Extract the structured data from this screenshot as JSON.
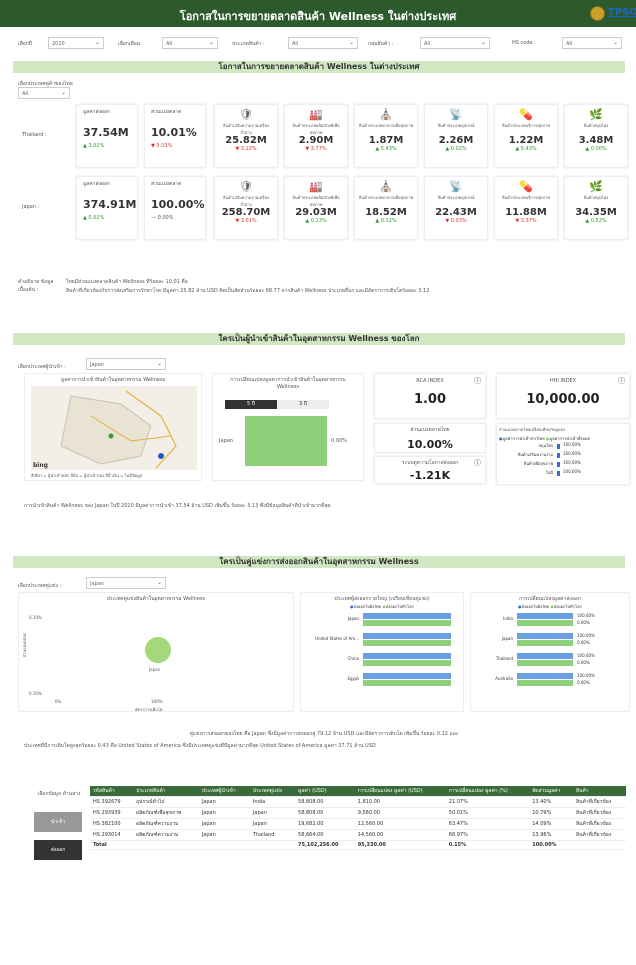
{
  "header": {
    "title": "โอกาสในการขยายตลาดสินค้า Wellness ในต่างประเทศ",
    "logo_text": "TPSO"
  },
  "filters": [
    {
      "label": "เลือกปี",
      "value": "2020"
    },
    {
      "label": "เลือกเดือน",
      "value": "All"
    },
    {
      "label": "ประเภทสินค้า :",
      "value": "All"
    },
    {
      "label": "กลุ่มสินค้า :",
      "value": "All"
    },
    {
      "label": "HS code :",
      "value": "All"
    }
  ],
  "section1": {
    "band": "โอกาสในการขยายตลาดสินค้า Wellness ในต่างประเทศ",
    "partner_label": "เลือกประเทศคู่ค้าของไทย",
    "partner_value": "All",
    "col_export": "มูลค่าส่งออก",
    "col_share": "ส่วนแบ่งตลาด",
    "categories": [
      "สินค้าเสริมความงามเครื่องสำอาง",
      "สินค้าประเภทผลิตภัณฑ์เพื่อสุขภาพ",
      "สินค้าประเภทอาหารเพื่อสุขภาพ",
      "สินค้าประเภทอุปกรณ์",
      "สินค้าประเภทบริการสุขภาพ",
      "สินค้าสมุนไพร"
    ],
    "rows": [
      {
        "country": "Thailand :",
        "export": "37.54M",
        "export_chg": "▲ 3.02%",
        "share": "10.01%",
        "share_chg": "▼ 3.03%",
        "cats": [
          {
            "v": "25.82M",
            "c": "▼ 3.12%",
            "d": "dn"
          },
          {
            "v": "2.90M",
            "c": "▼ 3.77%",
            "d": "dn"
          },
          {
            "v": "1.87M",
            "c": "▲ 5.43%",
            "d": "up"
          },
          {
            "v": "2.26M",
            "c": "▲ 0.02%",
            "d": "up"
          },
          {
            "v": "1.22M",
            "c": "▲ 5.43%",
            "d": "up"
          },
          {
            "v": "3.48M",
            "c": "▲ 0.00%",
            "d": "up"
          }
        ]
      },
      {
        "country": "Japan :",
        "export": "374.91M",
        "export_chg": "▲ 0.02%",
        "share": "100.00%",
        "share_chg": "— 0.00%",
        "cats": [
          {
            "v": "258.70M",
            "c": "▼ 3.01%",
            "d": "dn"
          },
          {
            "v": "29.03M",
            "c": "▲ 0.13%",
            "d": "up"
          },
          {
            "v": "18.52M",
            "c": "▲ 0.12%",
            "d": "up"
          },
          {
            "v": "22.43M",
            "c": "▼ 0.03%",
            "d": "dn"
          },
          {
            "v": "11.88M",
            "c": "▼ 3.37%",
            "d": "dn"
          },
          {
            "v": "34.35M",
            "c": "▲ 0.52%",
            "d": "up"
          }
        ]
      }
    ],
    "summary_label": "คำอธิบาย ข้อมูลเบื้องต้น :",
    "summary1": "ไทยมีส่วนแบ่งตลาดสินค้า Wellness ที่ร้อยละ 10.01 คือ",
    "summary2": "สินค้าที่เกี่ยวข้องกับการส่งเสริมการรักษาโรค มีมูลค่า 25.82 ล้าน USD คิดเป็นสัดส่วนร้อยละ 68.77 จากสินค้า Wellness ประเภทอื่นๆ และมีอัตราการเติบโตร้อยละ 3.12"
  },
  "section2": {
    "band": "ใครเป็นผู้นำเข้าสินค้าในอุตสาหกรรม Wellness ของโลก",
    "country_label": "เลือกประเทศผู้นำเข้า :",
    "country_value": "Japan",
    "map_title": "มูลค่าการนำเข้าสินค้าในอุตสาหกรรม Wellness",
    "map_caption": "สีเขียว = ผู้นำเข้าหลัก สีส้ม = ผู้นำเข้ารอง สีน้ำเงิน = ไม่มีข้อมูล",
    "map_brand": "bing",
    "bar_title": "การเปลี่ยนแปลงมูลค่าการนำเข้าสินค้าในอุตสาหกรรม Wellness",
    "bar_tabs": [
      "5 ปี",
      "3 ปี"
    ],
    "bar_label": "Japan",
    "bar_value": "0.00%",
    "rca_title": "RCA INDEX",
    "rca_value": "1.00",
    "hhi_title": "HHI INDEX",
    "hhi_value": "10,000.00",
    "share_title": "ส่วนแบ่งตลาดไทย",
    "share_value": "10.00%",
    "opp_title": "ระบบดูความโอกาสส่งออก",
    "opp_value": "-1.21K",
    "sub_title": "ส่วนแบ่งตลาดไทยเปรียบเทียบกับคู่แข่ง",
    "sub_legend": [
      "มูลค่าการนำเข้าจากไทย",
      "มูลค่าการนำเข้าทั้งหมด"
    ],
    "sub_rows": [
      {
        "label": "สมุนไพร",
        "value": "100.00%"
      },
      {
        "label": "สินค้าเสริมความงาม",
        "value": "100.00%"
      },
      {
        "label": "สินค้าเพื่อสุขภาพ",
        "value": "100.00%"
      },
      {
        "label": "ในปี",
        "value": "100.00%"
      }
    ],
    "sub_axis": [
      "0%",
      "50%",
      "100%"
    ],
    "desc": "การนำเข้าสินค้า Wellness ของ Japan ในปี 2020 มีมูลค่าการนำเข้า 37.54 ล้าน USD เพิ่มขึ้น ร้อยละ 3.13 ซึ่งมีข้อมูลสินค้าที่นำเข้ามากที่สุด"
  },
  "section3": {
    "band": "ใครเป็นคู่แข่งการส่งออกสินค้าในอุตสาหกรรม Wellness",
    "country_label": "เลือกประเทศคู่แข่ง :",
    "country_value": "Japan",
    "bubble_title": "ประเทศคู่แข่งสินค้าในอุตสาหกรรม Wellness",
    "bubble_label": "Japan",
    "bubble_ylabel": "ส่วนแบ่งตลาด",
    "bubble_xlabel": "อัตราการเติบโต",
    "bubble_yticks": [
      "0.10%",
      "0.10%"
    ],
    "bubble_xticks": [
      "0%",
      "100%"
    ],
    "bar2_title": "ประเทศผู้ส่งออกรายใหญ่ (เปรียบเทียบคู่แข่ง)",
    "bar2_legend": [
      "ส่งออกไปยังไทย",
      "ส่งออกไปทั่วโลก"
    ],
    "bar2_rows": [
      "Japan",
      "United States of Am...",
      "China",
      "Egypt"
    ],
    "bar3_title": "การเปลี่ยนแปลงมูลค่าส่งออก",
    "bar3_legend": [
      "ส่งออกไปยังไทย",
      "ส่งออกไปทั่วโลก"
    ],
    "bar3_rows": [
      {
        "label": "India",
        "v1": "0.00%",
        "v2": "100.00%"
      },
      {
        "label": "Japan",
        "v1": "0.00%",
        "v2": "100.00%"
      },
      {
        "label": "Thailand",
        "v1": "0.00%",
        "v2": "100.00%"
      },
      {
        "label": "Australia",
        "v1": "0.00%",
        "v2": "100.00%"
      }
    ],
    "desc1": "คู่แข่งการส่งออกของไทย คือ Japan ซึ่งมีมูลค่าการส่งออกสู่ 79.12 ล้าน USD และมีอัตราการเติบโต เพิ่มขึ้น ร้อยละ 0.12 และ",
    "desc2": "ประเทศที่มีการเติบโตสูงสุดร้อยละ 0.43 คือ United States of America ซึ่งมีประเทศคู่แข่งที่มีมูลค่ามากที่สุด United States of America มูลค่า 37.71 ล้าน USD"
  },
  "table": {
    "side_label": "เลือกข้อมูล ด้านล่าง",
    "side_buttons": [
      "นำเข้า",
      "ส่งออก"
    ],
    "headers": [
      "รหัสสินค้า",
      "ประเภทสินค้า",
      "ประเทศผู้นำเข้า",
      "ประเทศคู่แข่ง",
      "มูลค่า (USD)",
      "การเปลี่ยนแปลง มูลค่า (USD)",
      "การเปลี่ยนแปลง มูลค่า (%)",
      "สัดส่วนมูลค่า",
      "สินค้า"
    ],
    "rows": [
      [
        "HS 392679",
        "อุปกรณ์ทั่วไป",
        "Japan",
        "India",
        "58,808.00",
        "1,810.00",
        "21.07%",
        "13.40%",
        "สินค้าที่เกี่ยวข้อง"
      ],
      [
        "HS 293939",
        "ผลิตภัณฑ์เพื่อสุขภาพ",
        "Japan",
        "Japan",
        "58,808.00",
        "9,560.00",
        "50.01%",
        "10.79%",
        "สินค้าที่เกี่ยวข้อง"
      ],
      [
        "HS 382100",
        "ผลิตภัณฑ์ความงาม",
        "Japan",
        "Japan",
        "19,682.00",
        "12,560.00",
        "63.47%",
        "14.09%",
        "สินค้าที่เกี่ยวข้อง"
      ],
      [
        "HS 293014",
        "ผลิตภัณฑ์ความงาม",
        "Japan",
        "Thailand",
        "58,664.00",
        "14,560.00",
        "68.97%",
        "13.96%",
        "สินค้าที่เกี่ยวข้อง"
      ],
      [
        "Total",
        "",
        "",
        "",
        "75,102,256.00",
        "95,330.00",
        "0.15%",
        "100.00%",
        ""
      ]
    ]
  },
  "colors": {
    "header": "#2d5a2d",
    "band": "#cfe8c2",
    "up": "#2e9a2e",
    "down": "#d33",
    "bar_green": "#8fd07a",
    "bar_blue": "#6aa0e0"
  }
}
